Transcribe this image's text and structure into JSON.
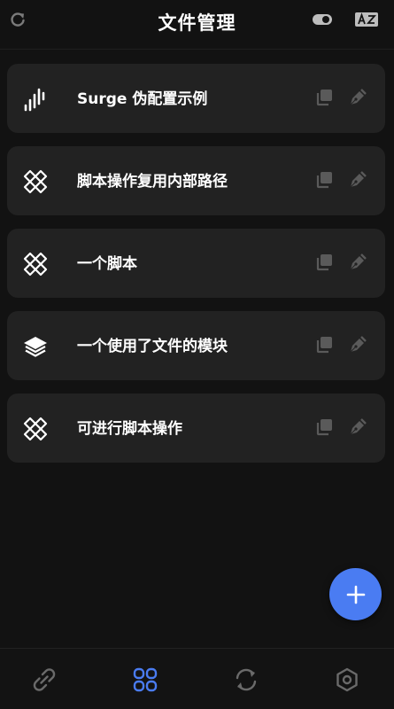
{
  "header": {
    "title": "文件管理",
    "refresh_icon": "refresh-icon",
    "toggle_icon": "toggle-icon",
    "translate_icon": "translate-icon"
  },
  "files": [
    {
      "name": "Surge 伪配置示例",
      "icon": "signal-bars-icon"
    },
    {
      "name": "脚本操作复用内部路径",
      "icon": "script-link-icon"
    },
    {
      "name": "一个脚本",
      "icon": "script-link-icon"
    },
    {
      "name": "一个使用了文件的模块",
      "icon": "layers-icon"
    },
    {
      "name": "可进行脚本操作",
      "icon": "script-link-icon"
    }
  ],
  "fab": {
    "icon": "plus-icon"
  },
  "nav": [
    {
      "icon": "link-icon",
      "active": false
    },
    {
      "icon": "grid-icon",
      "active": true
    },
    {
      "icon": "sync-icon",
      "active": false
    },
    {
      "icon": "hexagon-settings-icon",
      "active": false
    }
  ],
  "colors": {
    "background": "#121212",
    "card": "#222222",
    "accent": "#4a7cf2",
    "muted_icon": "#5a5a5a",
    "nav_icon": "#6a6a6a"
  }
}
